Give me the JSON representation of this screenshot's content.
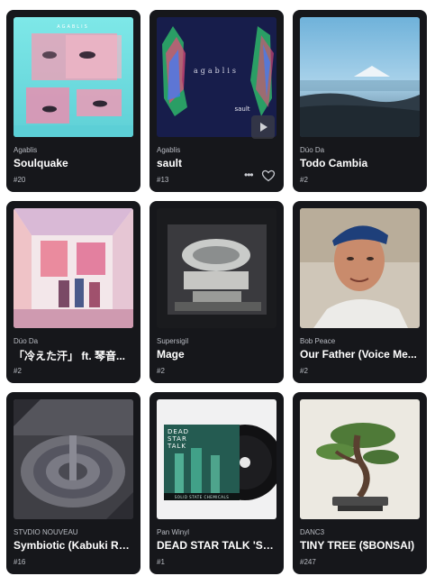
{
  "cards": [
    {
      "artist": "Agablis",
      "title": "Soulquake",
      "rank": "#20",
      "art_text": "AGABLIS"
    },
    {
      "artist": "Agablis",
      "title": "sault",
      "rank": "#13",
      "art_text": "agablis",
      "art_text2": "sault"
    },
    {
      "artist": "Dúo Da",
      "title": "Todo Cambia",
      "rank": "#2"
    },
    {
      "artist": "Dúo Da",
      "title": "「冷えた汗」 ft. 琴音...",
      "rank": "#2"
    },
    {
      "artist": "Supersigil",
      "title": "Mage",
      "rank": "#2"
    },
    {
      "artist": "Bob Peace",
      "title": "Our Father (Voice Me...",
      "rank": "#2"
    },
    {
      "artist": "STVDIO NOUVEAU",
      "title": "Symbiotic (Kabuki Re...",
      "rank": "#16"
    },
    {
      "artist": "Pan Winyl",
      "title": "DEAD STAR TALK 'Soli...",
      "rank": "#1",
      "art_text": "DEAD\nSTAR\nTALK",
      "art_text2": "SOLID STATE CHEMICALS"
    },
    {
      "artist": "DANC3",
      "title": "TINY TREE ($BONSAI)",
      "rank": "#247"
    }
  ],
  "icons": {
    "more": "more-horizontal-icon",
    "like": "heart-icon",
    "play": "play-icon"
  },
  "colors": {
    "card_bg": "#16171b",
    "title": "#ffffff",
    "muted": "#b9bcc3"
  }
}
